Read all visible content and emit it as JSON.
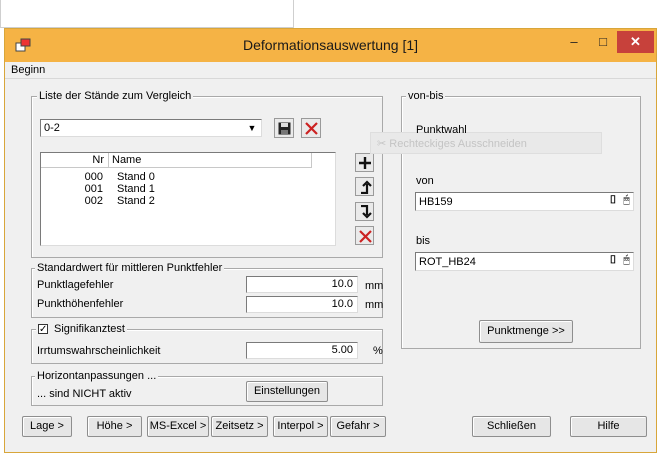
{
  "window": {
    "title": "Deformationsauswertung [1]",
    "menu": [
      "Beginn"
    ]
  },
  "comparison": {
    "legend": "Liste der Stände zum Vergleich",
    "selected": "0-2",
    "columns": [
      "Nr",
      "Name"
    ],
    "rows": [
      {
        "nr": "000",
        "name": "Stand 0"
      },
      {
        "nr": "001",
        "name": "Stand 1"
      },
      {
        "nr": "002",
        "name": "Stand 2"
      }
    ]
  },
  "errors": {
    "legend": "Standardwert für mittleren Punktfehler",
    "lage_label": "Punktlagefehler",
    "lage_value": "10.0",
    "lage_unit": "mm",
    "hoehe_label": "Punkthöhenfehler",
    "hoehe_value": "10.0",
    "hoehe_unit": "mm"
  },
  "significance": {
    "checkbox_label": "Signifikanztest",
    "checked": true,
    "prob_label": "Irrtumswahrscheinlichkeit",
    "prob_value": "5.00",
    "prob_unit": "%"
  },
  "horizon": {
    "legend": "Horizontanpassungen ...",
    "status": "... sind NICHT aktiv",
    "settings_button": "Einstellungen"
  },
  "vonbis": {
    "legend": "von-bis",
    "punktwahl": "Punktwahl",
    "von_label": "von",
    "von_value": "HB159",
    "bis_label": "bis",
    "bis_value": "ROT_HB24",
    "punktmenge_button": "Punktmenge >>",
    "ghost_text": "Rechteckiges Ausschneiden"
  },
  "bottom_buttons": [
    "Lage >",
    "Höhe >",
    "MS-Excel >",
    "Zeitsetz >",
    "Interpol >",
    "Gefahr >"
  ],
  "close_button": "Schließen",
  "help_button": "Hilfe",
  "colors": {
    "titlebar": "#f5b345",
    "close": "#c7413b",
    "delete_icon": "#cc2222"
  },
  "icons": [
    "app-icon",
    "minimize-icon",
    "maximize-icon",
    "close-icon",
    "save-icon",
    "delete-icon",
    "add-icon",
    "move-up-icon",
    "move-down-icon",
    "pick-icon"
  ]
}
